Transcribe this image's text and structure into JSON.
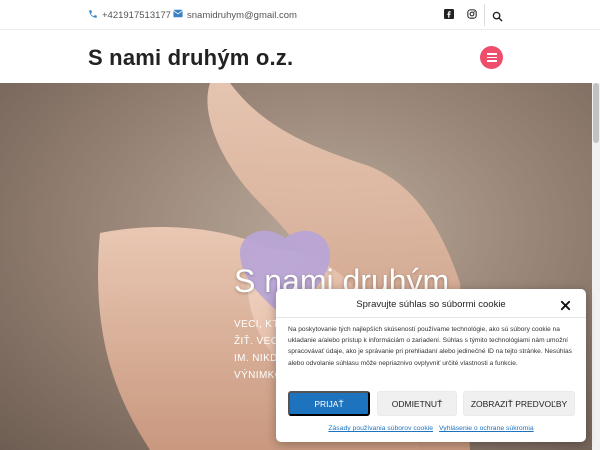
{
  "topbar": {
    "phone": "+421917513177",
    "email": "snamidruhym@gmail.com",
    "icons": [
      "phone-icon",
      "envelope-icon",
      "facebook-icon",
      "instagram-icon",
      "search-icon"
    ]
  },
  "header": {
    "site_title": "S nami druhým o.z."
  },
  "hero": {
    "title": "S nami druhým",
    "subtitle_lines": [
      "VECI, KTO",
      "ŽIŤ. VEC",
      "IM. NIKDY",
      "VÝNIMKO"
    ]
  },
  "cookie": {
    "title": "Spravujte súhlas so súbormi cookie",
    "text": "Na poskytovanie tých najlepších skúseností používame technológie, ako sú súbory cookie na ukladanie a/alebo prístup k informáciám o zariadení. Súhlas s týmito technológiami nám umožní spracovávať údaje, ako je správanie pri prehliadaní alebo jedinečné ID na tejto stránke. Nesúhlas alebo odvolanie súhlasu môže nepriaznivo ovplyvniť určité vlastnosti a funkcie.",
    "accept": "PRIJAŤ",
    "deny": "ODMIETNUŤ",
    "prefs": "ZOBRAZIŤ PREDVOĽBY",
    "link_cookies": "Zásady používania súborov cookie",
    "link_privacy": "Vyhlásenie o ochrane súkromia"
  },
  "colors": {
    "accent": "#ef4d6b",
    "primary_button": "#1e73be",
    "heart": "#b9a5d6"
  }
}
